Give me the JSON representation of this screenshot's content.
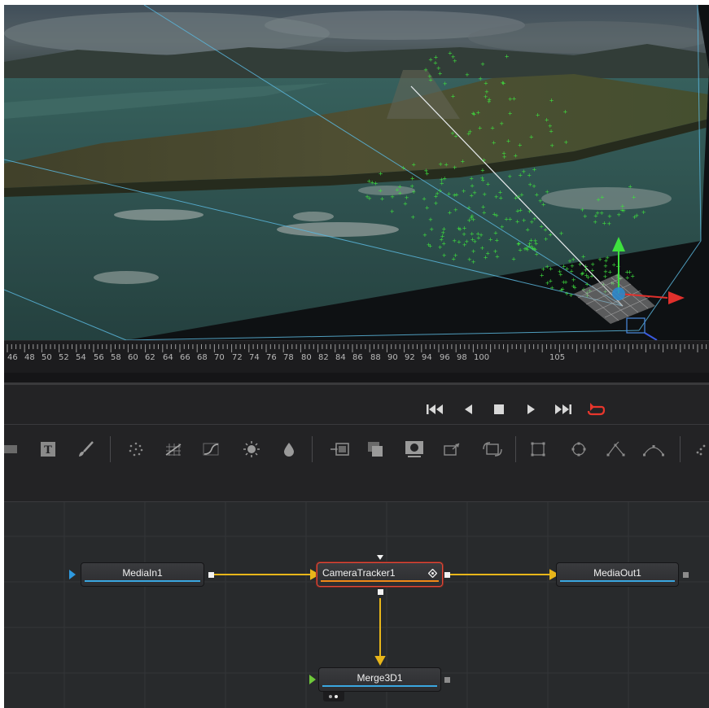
{
  "timeline": {
    "ticks": [
      "46",
      "48",
      "50",
      "52",
      "54",
      "56",
      "58",
      "60",
      "62",
      "64",
      "66",
      "68",
      "70",
      "72",
      "74",
      "76",
      "78",
      "80",
      "82",
      "84",
      "86",
      "88",
      "90",
      "92",
      "94",
      "96",
      "98",
      "100",
      "105"
    ]
  },
  "transport": {
    "buttons": [
      "go-to-start",
      "step-back",
      "stop",
      "play",
      "go-to-end",
      "loop"
    ]
  },
  "toolbar": {
    "tools": [
      "image-plane-icon",
      "text-icon",
      "paint-icon",
      "particles-icon",
      "color-correct-icon",
      "curves-icon",
      "brightness-contrast-icon",
      "blur-icon",
      "background-icon",
      "merge-icon",
      "mask-icon",
      "transform-icon",
      "resize-icon",
      "rectangle-mask-icon",
      "ellipse-mask-icon",
      "polygon-mask-icon",
      "bspline-mask-icon",
      "more-icon"
    ]
  },
  "nodes": {
    "media_in": "MediaIn1",
    "camera_tracker": "CameraTracker1",
    "media_out": "MediaOut1",
    "merge3d": "Merge3D1"
  },
  "colors": {
    "accent_orange": "#f08a18",
    "selected_border": "#e04a3a",
    "link_yellow": "#e8b61a",
    "node_bar_blue": "#3aa7e0",
    "loop_red": "#e8362c"
  }
}
